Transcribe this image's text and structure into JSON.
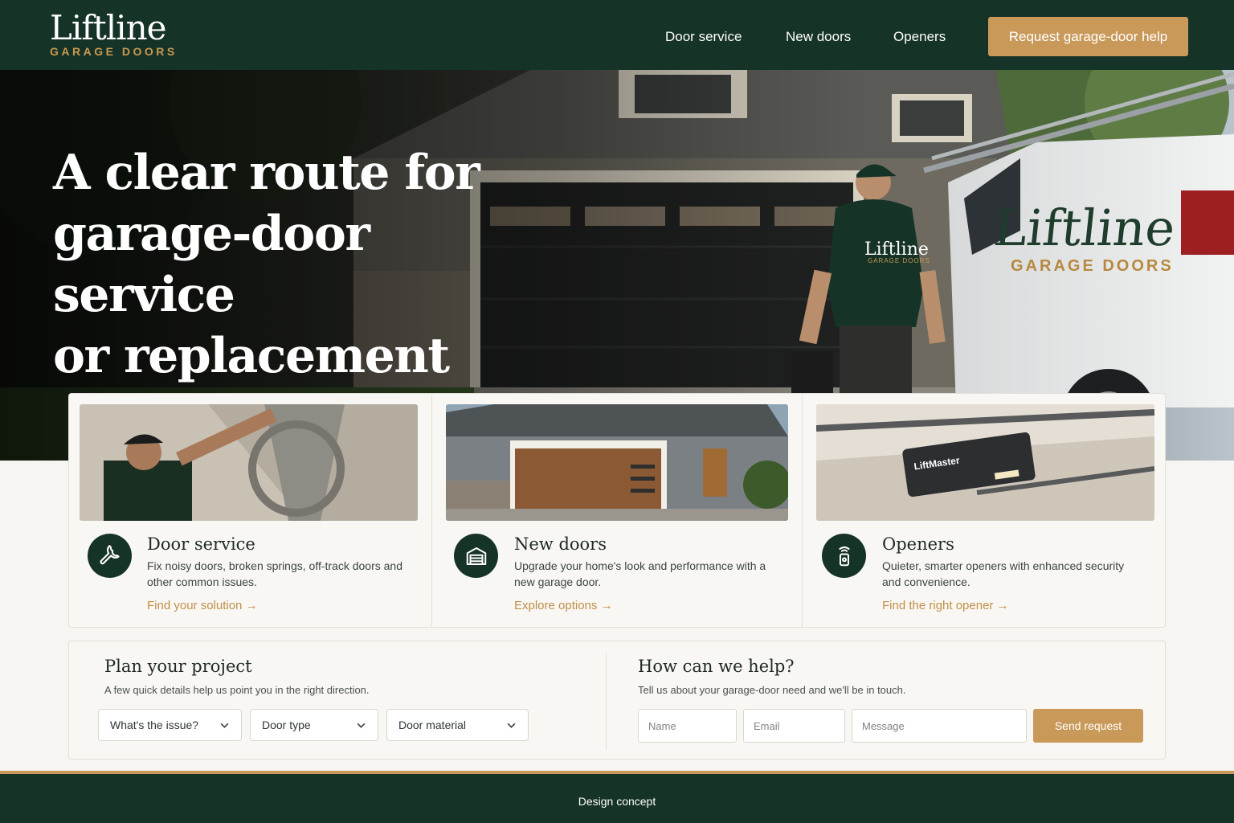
{
  "header": {
    "logo_word": "Liftline",
    "logo_sub": "GARAGE DOORS",
    "nav": [
      "Door service",
      "New doors",
      "Openers"
    ],
    "cta": "Request garage-door help"
  },
  "hero": {
    "title_lines": [
      "A clear route for",
      "garage-door service",
      "or replacement"
    ],
    "van_logo_word": "Liftline",
    "van_logo_sub": "GARAGE DOORS",
    "shirt_logo_word": "Liftline",
    "shirt_logo_sub": "GARAGE DOORS"
  },
  "cards": [
    {
      "title": "Door service",
      "desc": "Fix noisy doors, broken springs, off-track doors and other common issues.",
      "link": "Find your solution",
      "icon": "wrench-icon"
    },
    {
      "title": "New doors",
      "desc": "Upgrade your home's look and performance with a new garage door.",
      "link": "Explore options",
      "icon": "garage-icon"
    },
    {
      "title": "Openers",
      "desc": "Quieter, smarter openers with enhanced security and convenience.",
      "link": "Find the right opener",
      "icon": "remote-icon",
      "opener_brand": "LiftMaster"
    }
  ],
  "plan": {
    "title": "Plan your project",
    "subtitle": "A few quick details help us point you in the right direction.",
    "selects": [
      "What's the issue?",
      "Door type",
      "Door material"
    ]
  },
  "help": {
    "title": "How can we help?",
    "subtitle": "Tell us about your garage-door need and we'll be in touch.",
    "placeholders": {
      "name": "Name",
      "email": "Email",
      "message": "Message"
    },
    "send": "Send request"
  },
  "footer": {
    "text": "Design concept"
  },
  "colors": {
    "brand_green": "#163327",
    "accent_gold": "#c9995a",
    "background": "#f6f5f1"
  }
}
